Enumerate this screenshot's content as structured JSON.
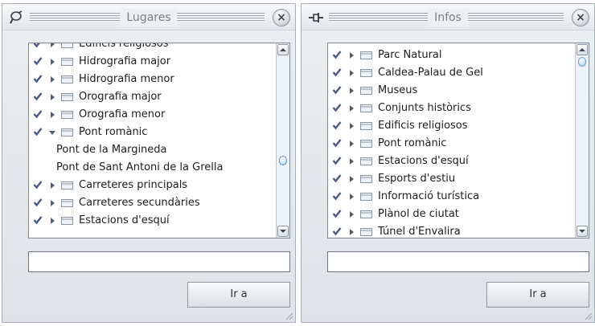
{
  "panels": [
    {
      "title": "Lugares",
      "pin_icon": "pushpin-icon",
      "close_label": "×",
      "go_label": "Ir a",
      "input_value": "",
      "scroll_fraction": 0.62,
      "items": [
        {
          "label": "Edificis religiosos",
          "checked": true,
          "expanded": false,
          "type": "folder"
        },
        {
          "label": "Hidrografia major",
          "checked": true,
          "expanded": false,
          "type": "folder"
        },
        {
          "label": "Hidrografia menor",
          "checked": true,
          "expanded": false,
          "type": "folder"
        },
        {
          "label": "Orografia major",
          "checked": true,
          "expanded": false,
          "type": "folder"
        },
        {
          "label": "Orografia menor",
          "checked": true,
          "expanded": false,
          "type": "folder"
        },
        {
          "label": "Pont romànic",
          "checked": true,
          "expanded": true,
          "type": "folder"
        },
        {
          "label": "Pont de la Margineda",
          "type": "leaf"
        },
        {
          "label": "Pont de Sant Antoni de la Grella",
          "type": "leaf"
        },
        {
          "label": "Carreteres principals",
          "checked": true,
          "expanded": false,
          "type": "folder"
        },
        {
          "label": "Carreteres secundàries",
          "checked": true,
          "expanded": false,
          "type": "folder"
        },
        {
          "label": "Estacions d'esquí",
          "checked": true,
          "expanded": false,
          "type": "folder"
        }
      ]
    },
    {
      "title": "Infos",
      "pin_icon": "pin-flat-icon",
      "close_label": "×",
      "go_label": "Ir a",
      "input_value": "",
      "scroll_fraction": 0.0,
      "items": [
        {
          "label": "Parc Natural",
          "checked": true,
          "expanded": false,
          "type": "folder"
        },
        {
          "label": "Caldea-Palau de Gel",
          "checked": true,
          "expanded": false,
          "type": "folder"
        },
        {
          "label": "Museus",
          "checked": true,
          "expanded": false,
          "type": "folder"
        },
        {
          "label": "Conjunts històrics",
          "checked": true,
          "expanded": false,
          "type": "folder"
        },
        {
          "label": "Edificis religiosos",
          "checked": true,
          "expanded": false,
          "type": "folder"
        },
        {
          "label": "Pont romànic",
          "checked": true,
          "expanded": false,
          "type": "folder"
        },
        {
          "label": "Estacions d'esquí",
          "checked": true,
          "expanded": false,
          "type": "folder"
        },
        {
          "label": "Esports d'estiu",
          "checked": true,
          "expanded": false,
          "type": "folder"
        },
        {
          "label": "Informació turística",
          "checked": true,
          "expanded": false,
          "type": "folder"
        },
        {
          "label": "Plànol de ciutat",
          "checked": true,
          "expanded": false,
          "type": "folder"
        },
        {
          "label": "Túnel d'Envalira",
          "checked": true,
          "expanded": false,
          "type": "folder"
        }
      ]
    }
  ],
  "colors": {
    "check": "#4a5a86",
    "folder_fill": "#eef2f6",
    "folder_stroke": "#8c96a1",
    "arrow": "#55606c"
  }
}
